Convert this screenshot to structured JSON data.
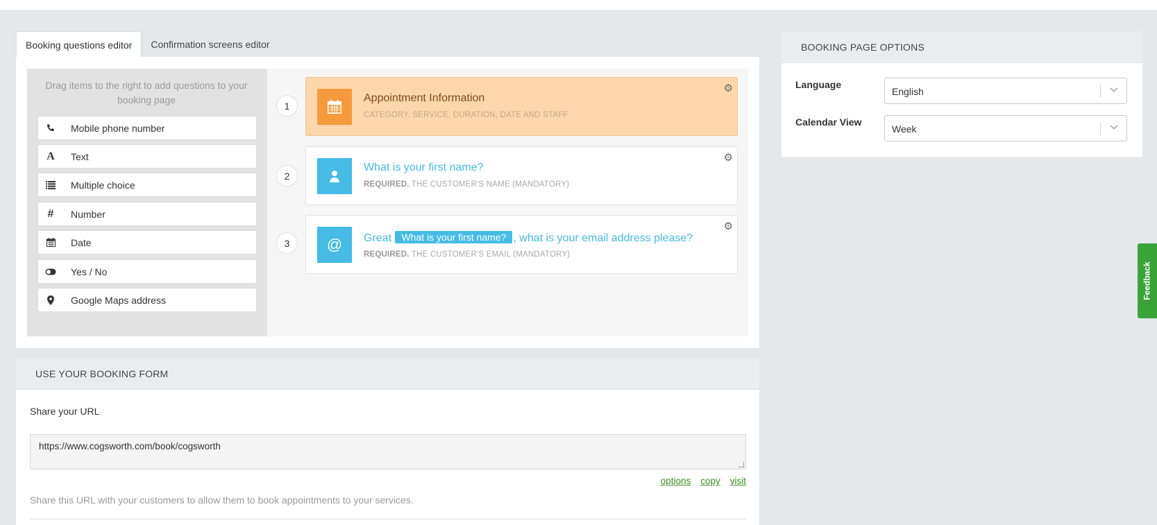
{
  "tabs": [
    {
      "label": "Booking questions editor",
      "active": true
    },
    {
      "label": "Confirmation screens editor",
      "active": false
    }
  ],
  "palette": {
    "hint": "Drag items to the right to add questions to your booking page",
    "items": [
      {
        "label": "Mobile phone number",
        "icon": "phone-icon"
      },
      {
        "label": "Text",
        "icon": "text-icon"
      },
      {
        "label": "Multiple choice",
        "icon": "list-icon"
      },
      {
        "label": "Number",
        "icon": "hash-icon"
      },
      {
        "label": "Date",
        "icon": "calendar-icon"
      },
      {
        "label": "Yes / No",
        "icon": "toggle-icon"
      },
      {
        "label": "Google Maps address",
        "icon": "map-pin-icon"
      }
    ]
  },
  "questions": [
    {
      "number": "1",
      "title": "Appointment Information",
      "sub_prefix": "",
      "sub": "CATEGORY, SERVICE, DURATION, DATE AND STAFF",
      "icon": "calendar-icon",
      "color": "#f79a3d"
    },
    {
      "number": "2",
      "title": "What is your first name?",
      "sub_prefix": "REQUIRED.",
      "sub": "THE CUSTOMER'S NAME (MANDATORY)",
      "icon": "user-icon",
      "color": "#45bbe6"
    },
    {
      "number": "3",
      "title_before": "Great",
      "title_pill": "What is your first name?",
      "title_after": ", what is your email address please?",
      "sub_prefix": "REQUIRED.",
      "sub": "THE CUSTOMER'S EMAIL (MANDATORY)",
      "icon": "at-icon",
      "color": "#45bbe6"
    }
  ],
  "use_form": {
    "heading": "USE YOUR BOOKING FORM",
    "share_label": "Share your URL",
    "url": "https://www.cogsworth.com/book/cogsworth",
    "links": [
      "options",
      "copy",
      "visit"
    ],
    "help": "Share this URL with your customers to allow them to book appointments to your services."
  },
  "options": {
    "heading": "BOOKING PAGE OPTIONS",
    "language_label": "Language",
    "language_value": "English",
    "calendar_label": "Calendar View",
    "calendar_value": "Week"
  },
  "feedback": {
    "label": "Feedback",
    "color": "#3aa33a"
  }
}
